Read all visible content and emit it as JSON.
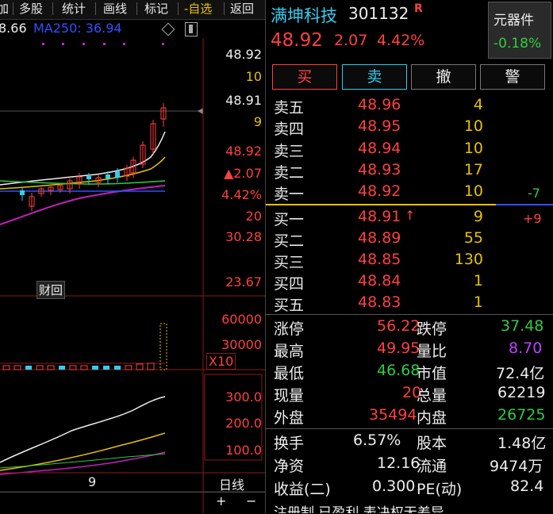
{
  "toolbar": {
    "items": [
      "加",
      "多股",
      "统计",
      "画线",
      "标记",
      "-自选",
      "返回"
    ]
  },
  "indicator": {
    "prev_value": "8.66",
    "ma250_label": "MA250: 36.94"
  },
  "chart": {
    "price_axis": [
      "48.92",
      "10",
      "48.91",
      "9",
      "48.92",
      "▲2.07",
      "4.42%",
      "20",
      "30.28",
      "23.67"
    ],
    "vol_axis": [
      "60000",
      "30000",
      "X10"
    ],
    "macd_axis": [
      "300.0",
      "200.0",
      "100.0"
    ],
    "date_label": "9",
    "period_label": "日线",
    "plus_label": "+",
    "minus_label": "−",
    "caihui_label": "财回"
  },
  "stock": {
    "name": "满坤科技",
    "code": "301132",
    "badge": "R",
    "price": "48.92",
    "change": "2.07",
    "change_pct": "4.42%",
    "sector_name": "元器件",
    "sector_pct": "-0.18%"
  },
  "buttons": {
    "buy": "买",
    "sell": "卖",
    "cancel": "撤",
    "alert": "警"
  },
  "order_book": {
    "asks": [
      {
        "label": "卖五",
        "price": "48.96",
        "vol": "4",
        "extra": ""
      },
      {
        "label": "卖四",
        "price": "48.95",
        "vol": "10",
        "extra": ""
      },
      {
        "label": "卖三",
        "price": "48.94",
        "vol": "10",
        "extra": ""
      },
      {
        "label": "卖二",
        "price": "48.93",
        "vol": "17",
        "extra": ""
      },
      {
        "label": "卖一",
        "price": "48.92",
        "vol": "10",
        "extra": "-7"
      }
    ],
    "bids": [
      {
        "label": "买一",
        "price": "48.91",
        "vol": "9",
        "extra": "+9"
      },
      {
        "label": "买二",
        "price": "48.89",
        "vol": "55",
        "extra": ""
      },
      {
        "label": "买三",
        "price": "48.85",
        "vol": "130",
        "extra": ""
      },
      {
        "label": "买四",
        "price": "48.84",
        "vol": "1",
        "extra": ""
      },
      {
        "label": "买五",
        "price": "48.83",
        "vol": "1",
        "extra": ""
      }
    ]
  },
  "stats": {
    "limit_up_label": "涨停",
    "limit_up": "56.22",
    "limit_down_label": "跌停",
    "limit_down": "37.48",
    "high_label": "最高",
    "high": "49.95",
    "vol_ratio_label": "量比",
    "vol_ratio": "8.70",
    "low_label": "最低",
    "low": "46.68",
    "mkt_cap_label": "市值",
    "mkt_cap": "72.4亿",
    "cur_vol_label": "现量",
    "cur_vol": "20",
    "total_vol_label": "总量",
    "total_vol": "62219",
    "outer_label": "外盘",
    "outer": "35494",
    "inner_label": "内盘",
    "inner": "26725",
    "turnover_label": "换手",
    "turnover": "6.57%",
    "share_cap_label": "股本",
    "share_cap": "1.48亿",
    "net_asset_label": "净资",
    "net_asset": "12.16",
    "float_label": "流通",
    "float": "9474万",
    "eps_label": "收益(二)",
    "eps": "0.300",
    "pe_label": "PE(动)",
    "pe": "82.4"
  },
  "footer_text": "注册制 已盈利 表决权无差异",
  "colors": {
    "up": "#ff4040",
    "down": "#2ecc40",
    "neutral": "#e6c200",
    "accent": "#33ccee"
  }
}
